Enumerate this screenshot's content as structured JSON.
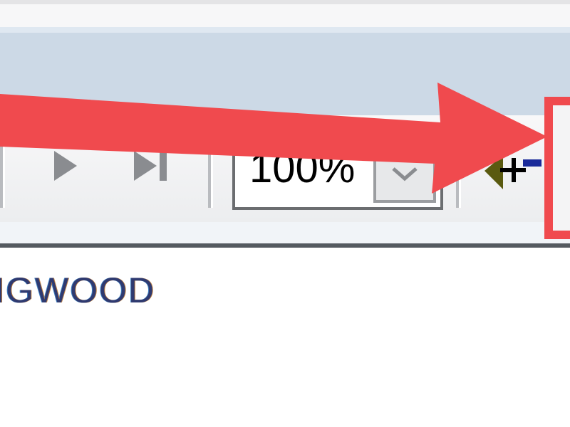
{
  "toolbar": {
    "zoom_value": "100%"
  },
  "document": {
    "lines": [
      "NGWOOD"
    ],
    "text_color": "#2f3a70"
  },
  "icons": {
    "next_page": "triangle-right-icon",
    "last_page": "skip-to-end-icon",
    "zoom_dropdown": "chevron-down-icon",
    "find": "find-text-icon"
  },
  "annotation": {
    "arrow_color": "#f04a4e",
    "highlight_color": "#f04a4e"
  },
  "colors": {
    "titlebar": "#ccd9e6",
    "toolbar": "#f0f1f3",
    "accent": "#f04a4e"
  }
}
